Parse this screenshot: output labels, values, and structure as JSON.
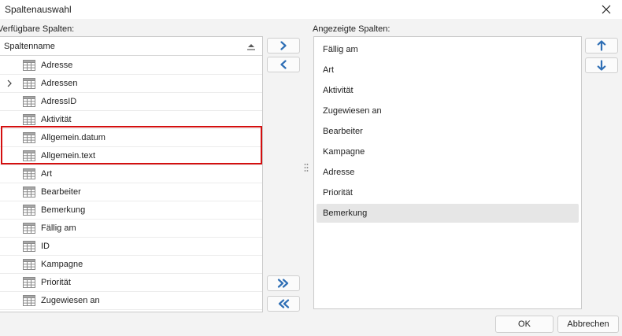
{
  "window": {
    "title": "Spaltenauswahl"
  },
  "available": {
    "label": "Verfügbare Spalten:",
    "header": "Spaltenname",
    "items": [
      {
        "label": "Adresse",
        "expandable": false
      },
      {
        "label": "Adressen",
        "expandable": true
      },
      {
        "label": "AdressID",
        "expandable": false
      },
      {
        "label": "Aktivität",
        "expandable": false
      },
      {
        "label": "Allgemein.datum",
        "expandable": false
      },
      {
        "label": "Allgemein.text",
        "expandable": false
      },
      {
        "label": "Art",
        "expandable": false
      },
      {
        "label": "Bearbeiter",
        "expandable": false
      },
      {
        "label": "Bemerkung",
        "expandable": false
      },
      {
        "label": "Fällig am",
        "expandable": false
      },
      {
        "label": "ID",
        "expandable": false
      },
      {
        "label": "Kampagne",
        "expandable": false
      },
      {
        "label": "Priorität",
        "expandable": false
      },
      {
        "label": "Zugewiesen an",
        "expandable": false
      }
    ]
  },
  "shown": {
    "label": "Angezeigte Spalten:",
    "items": [
      {
        "label": "Fällig am"
      },
      {
        "label": "Art"
      },
      {
        "label": "Aktivität"
      },
      {
        "label": "Zugewiesen an"
      },
      {
        "label": "Bearbeiter"
      },
      {
        "label": "Kampagne"
      },
      {
        "label": "Adresse"
      },
      {
        "label": "Priorität"
      },
      {
        "label": "Bemerkung",
        "selected": true
      }
    ]
  },
  "buttons": {
    "ok": "OK",
    "cancel": "Abbrechen"
  },
  "colors": {
    "accent": "#2f6fb5",
    "highlight": "#d40f0f",
    "selected_row": "#e6e6e6"
  },
  "icons": {
    "close": "close-icon",
    "sort": "sort-icon",
    "expand": "chevron-right-icon",
    "table": "table-icon",
    "add": "chevron-right-icon",
    "remove": "chevron-left-icon",
    "add_all": "double-chevron-right-icon",
    "remove_all": "double-chevron-left-icon",
    "move_up": "arrow-up-icon",
    "move_down": "arrow-down-icon"
  }
}
